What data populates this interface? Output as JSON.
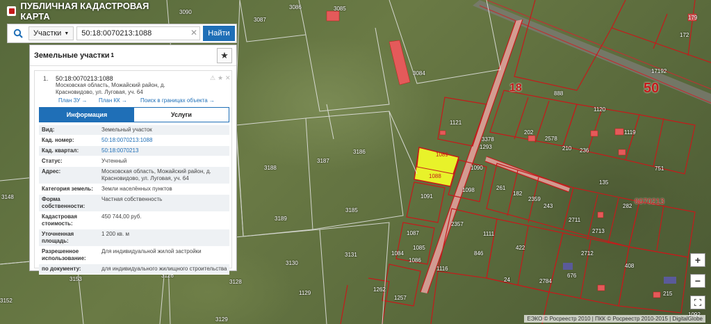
{
  "app": {
    "title": "ПУБЛИЧНАЯ КАДАСТРОВАЯ КАРТА"
  },
  "search": {
    "type_label": "Участки",
    "query": "50:18:0070213:1088",
    "find_label": "Найти"
  },
  "results": {
    "title": "Земельные участки",
    "count": "1",
    "item": {
      "number": "1.",
      "cad_number": "50:18:0070213:1088",
      "address_line": "Московская область, Можайский район, д. Красновидово, ул. Луговая, уч. 64",
      "links": {
        "plan_zu": "План ЗУ →",
        "plan_kk": "План КК →",
        "search_bounds": "Поиск в границах объекта →"
      },
      "tabs": {
        "info": "Информация",
        "services": "Услуги"
      },
      "props": [
        {
          "key": "Вид:",
          "value": "Земельный участок"
        },
        {
          "key": "Кад. номер:",
          "value": "50:18:0070213:1088"
        },
        {
          "key": "Кад. квартал:",
          "value": "50:18:0070213"
        },
        {
          "key": "Статус:",
          "value": "Учтенный"
        },
        {
          "key": "Адрес:",
          "value": "Московская область, Можайский район, д. Красновидово, ул. Луговая, уч. 64"
        },
        {
          "key": "Категория земель:",
          "value": "Земли населённых пунктов"
        },
        {
          "key": "Форма собственности:",
          "value": "Частная собственность"
        },
        {
          "key": "Кадастровая стоимость:",
          "value": "450 744,00 руб."
        },
        {
          "key": "Уточненная площадь:",
          "value": "1 200 кв. м"
        },
        {
          "key": "Разрешенное использование:",
          "value": "Для индивидуальной жилой застройки"
        },
        {
          "key": "по документу:",
          "value": "для индивидуального жилищного строительства"
        }
      ]
    }
  },
  "map": {
    "labels": [
      "3090",
      "3086",
      "3085",
      "3087",
      "3084",
      "3148",
      "3188",
      "3187",
      "3186",
      "3189",
      "3185",
      "3131",
      "3130",
      "3126",
      "3153",
      "3152",
      "3128",
      "3129",
      "1129",
      "1121",
      "1089",
      "1088",
      "1090",
      "1091",
      "1098",
      "1087",
      "1085",
      "1084",
      "1086",
      "2357",
      "1116",
      "888",
      "1120",
      "1119",
      "3378",
      "1293",
      "202",
      "2578",
      "210",
      "236",
      "135",
      "751",
      "282",
      "261",
      "182",
      "2359",
      "243",
      "2711",
      "2713",
      "2712",
      "1111",
      "422",
      "846",
      "676",
      "408",
      "24",
      "2784",
      "215",
      "1092",
      "179",
      "172",
      "17192",
      "1262",
      "1257"
    ],
    "quarter_number": "18",
    "district_number": "50",
    "kv_label": "0070213",
    "highlight_color": "#e8f22a"
  },
  "zoom": {
    "in": "+",
    "out": "−"
  },
  "attribution": "ЕЭКО © Росреестр 2010 | ПКК © Росреестр 2010-2015 | DigitalGlobe"
}
